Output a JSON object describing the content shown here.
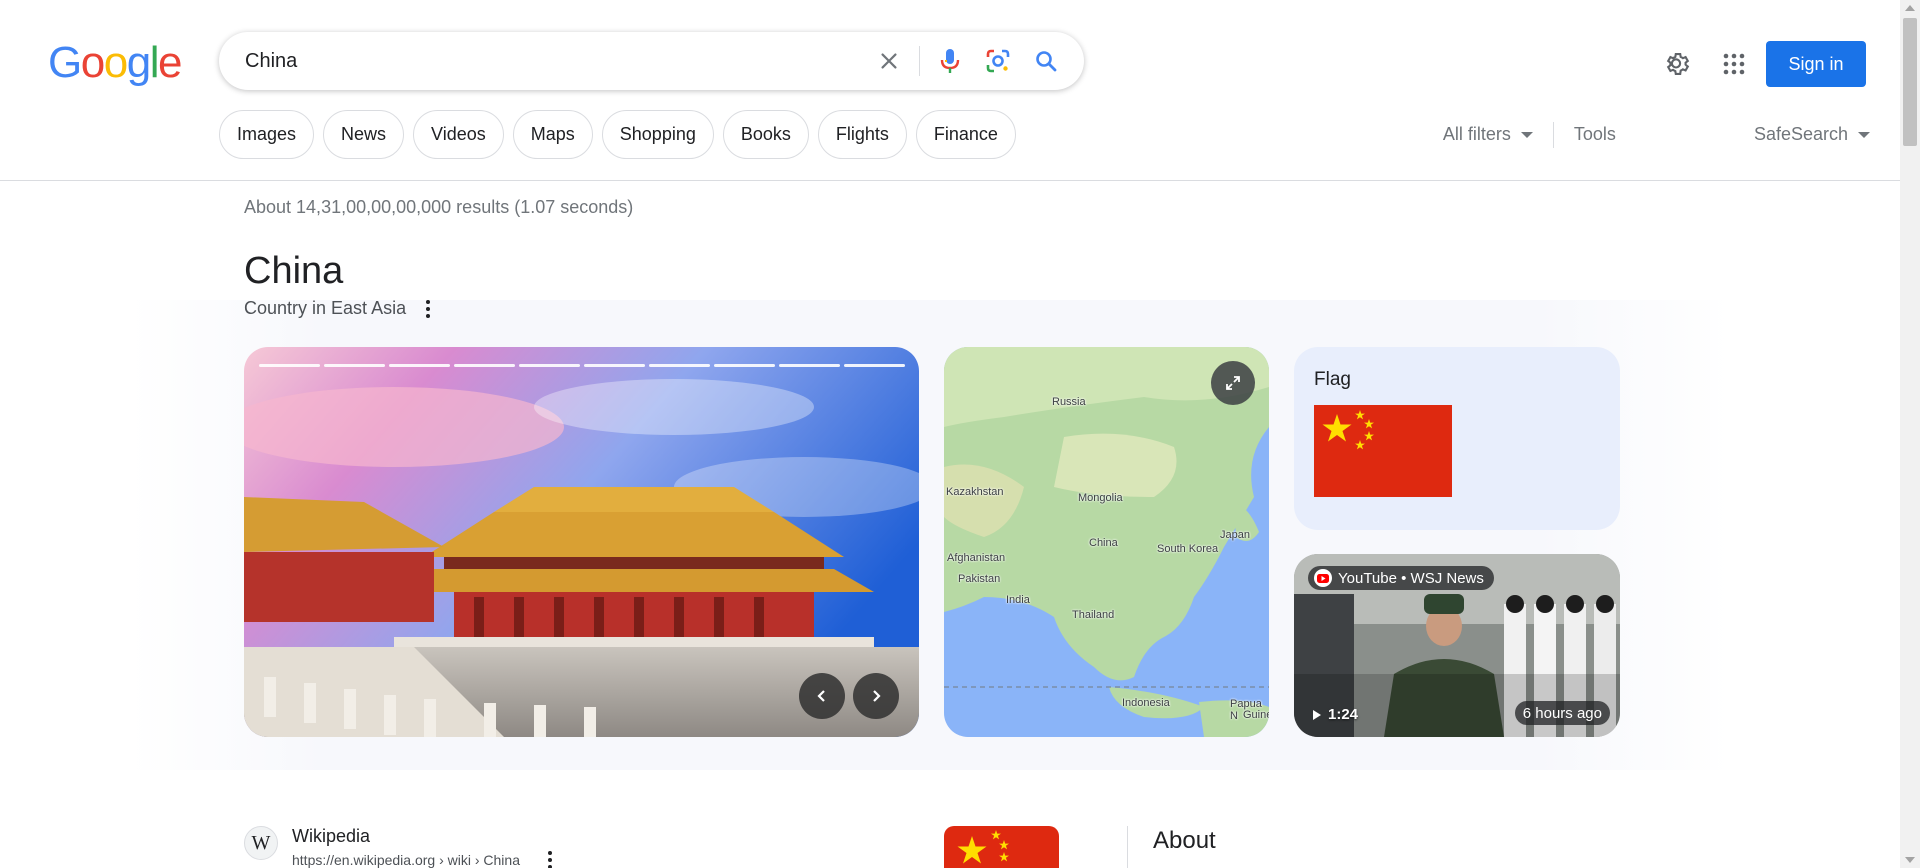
{
  "header": {
    "logo_letters": [
      "G",
      "o",
      "o",
      "g",
      "l",
      "e"
    ],
    "logo_colors": [
      "#4285F4",
      "#EA4335",
      "#FBBC05",
      "#4285F4",
      "#34A853",
      "#EA4335"
    ],
    "search_value": "China",
    "sign_in_label": "Sign in",
    "accent_color": "#1a73e8"
  },
  "chips": [
    "Images",
    "News",
    "Videos",
    "Maps",
    "Shopping",
    "Books",
    "Flights",
    "Finance"
  ],
  "filters": {
    "all_filters": "All filters",
    "tools": "Tools",
    "safesearch": "SafeSearch"
  },
  "results_stats": "About 14,31,00,00,00,000 results (1.07 seconds)",
  "knowledge_panel": {
    "title": "China",
    "subtitle": "Country in East Asia",
    "map_labels": {
      "russia": "Russia",
      "kazakhstan": "Kazakhstan",
      "mongolia": "Mongolia",
      "china": "China",
      "japan": "Japan",
      "south_korea": "South Korea",
      "afghanistan": "Afghanistan",
      "pakistan": "Pakistan",
      "india": "India",
      "thailand": "Thailand",
      "indonesia": "Indonesia",
      "papua": "Papua N",
      "guinea": "Guine"
    },
    "flag_label": "Flag",
    "video": {
      "source": "YouTube • WSJ News",
      "duration": "1:24",
      "age": "6 hours ago"
    }
  },
  "wiki_result": {
    "favicon_letter": "W",
    "site": "Wikipedia",
    "url": "https://en.wikipedia.org › wiki › China"
  },
  "about": {
    "title": "About"
  }
}
